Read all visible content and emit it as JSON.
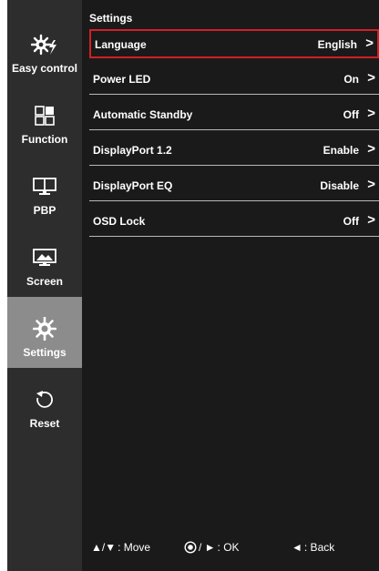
{
  "sidebar": {
    "items": [
      {
        "label": "Easy control",
        "icon": "easy-control-icon",
        "active": false
      },
      {
        "label": "Function",
        "icon": "function-icon",
        "active": false
      },
      {
        "label": "PBP",
        "icon": "pbp-icon",
        "active": false
      },
      {
        "label": "Screen",
        "icon": "screen-icon",
        "active": false
      },
      {
        "label": "Settings",
        "icon": "settings-icon",
        "active": true
      },
      {
        "label": "Reset",
        "icon": "reset-icon",
        "active": false
      }
    ]
  },
  "main": {
    "title": "Settings",
    "rows": [
      {
        "label": "Language",
        "value": "English",
        "arrow": ">",
        "selected": true
      },
      {
        "label": "Power LED",
        "value": "On",
        "arrow": ">",
        "selected": false
      },
      {
        "label": "Automatic Standby",
        "value": "Off",
        "arrow": ">",
        "selected": false
      },
      {
        "label": "DisplayPort 1.2",
        "value": "Enable",
        "arrow": ">",
        "selected": false
      },
      {
        "label": "DisplayPort EQ",
        "value": "Disable",
        "arrow": ">",
        "selected": false
      },
      {
        "label": "OSD Lock",
        "value": "Off",
        "arrow": ">",
        "selected": false
      }
    ]
  },
  "footer": {
    "move_glyph": "▲/▼",
    "move_text": ": Move",
    "ok_glyph": "/ ►",
    "ok_text": ": OK",
    "back_glyph": "◄",
    "back_text": ": Back"
  },
  "colors": {
    "panel": "#1a1a1a",
    "sidebar": "#2d2d2d",
    "sidebar_active": "#8c8c8c",
    "selection_border": "#d02025",
    "divider": "#b8b8b8",
    "text": "#ffffff"
  }
}
